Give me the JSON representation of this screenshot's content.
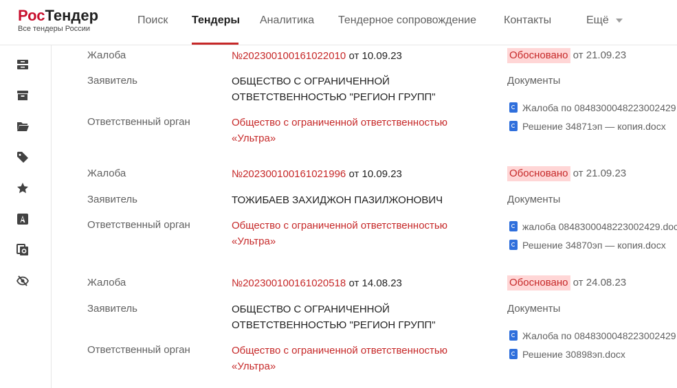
{
  "header": {
    "logo_part1": "Рос",
    "logo_part2": "Тендер",
    "logo_sub": "Все тендеры России",
    "nav": [
      "Поиск",
      "Тендеры",
      "Аналитика",
      "Тендерное сопровождение",
      "Контакты",
      "Ещё"
    ],
    "active_nav": "Тендеры"
  },
  "sidebar": {
    "icons": [
      "list-icon",
      "archive-icon",
      "folder-icon",
      "tag-icon",
      "star-icon",
      "font-icon",
      "copy-search-icon",
      "eye-off-icon"
    ]
  },
  "labels": {
    "complaint": "Жалоба",
    "applicant": "Заявитель",
    "authority": "Ответственный орган",
    "from": "от",
    "documents": "Документы"
  },
  "complaints": [
    {
      "number": "№202300100161022010",
      "date": "10.09.23",
      "applicant_line1": "ОБЩЕСТВО С ОГРАНИЧЕННОЙ",
      "applicant_line2": "ОТВЕТСТВЕННОСТЬЮ \"РЕГИОН ГРУПП\"",
      "authority_line1": "Общество с ограниченной ответственностью",
      "authority_line2": "«Ультра»",
      "status": "Обосновано",
      "status_date": "21.09.23",
      "docs": [
        "Жалоба по 0848300048223002429",
        "Решение 34871эп — копия.docx"
      ]
    },
    {
      "number": "№202300100161021996",
      "date": "10.09.23",
      "applicant_line1": "ТОЖИБАЕВ ЗАХИДЖОН ПАЗИЛЖОНОВИЧ",
      "applicant_line2": "",
      "authority_line1": "Общество с ограниченной ответственностью",
      "authority_line2": "«Ультра»",
      "status": "Обосновано",
      "status_date": "21.09.23",
      "docs": [
        "жалоба 0848300048223002429.doc",
        "Решение 34870эп — копия.docx"
      ]
    },
    {
      "number": "№202300100161020518",
      "date": "14.08.23",
      "applicant_line1": "ОБЩЕСТВО С ОГРАНИЧЕННОЙ",
      "applicant_line2": "ОТВЕТСТВЕННОСТЬЮ \"РЕГИОН ГРУПП\"",
      "authority_line1": "Общество с ограниченной ответственностью",
      "authority_line2": "«Ультра»",
      "status": "Обосновано",
      "status_date": "24.08.23",
      "docs": [
        "Жалоба по 0848300048223002429",
        "Решение 30898эп.docx"
      ]
    }
  ],
  "colors": {
    "brand_red": "#c62828",
    "badge_bg": "#ffd6d6",
    "doc_icon": "#2f6fdc"
  }
}
